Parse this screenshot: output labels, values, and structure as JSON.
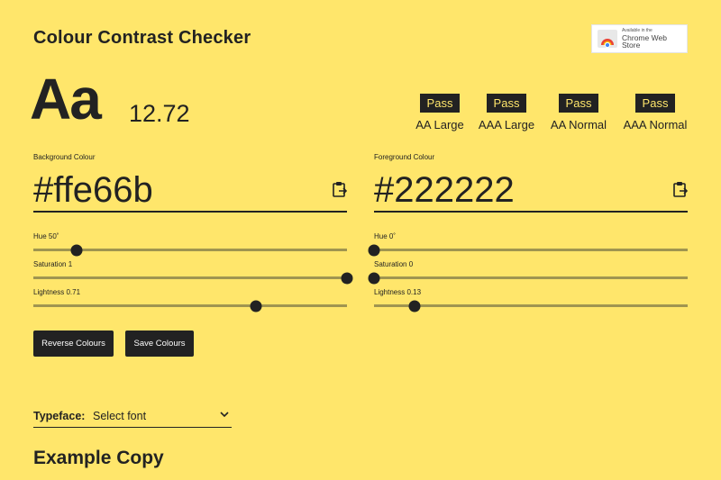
{
  "header": {
    "title": "Colour Contrast Checker"
  },
  "store_badge": {
    "line1": "Available in the",
    "line2": "Chrome Web Store"
  },
  "sample": {
    "glyphs": "Aa",
    "ratio": "12.72"
  },
  "ratings": [
    {
      "status": "Pass",
      "label": "AA Large"
    },
    {
      "status": "Pass",
      "label": "AAA Large"
    },
    {
      "status": "Pass",
      "label": "AA Normal"
    },
    {
      "status": "Pass",
      "label": "AAA Normal"
    }
  ],
  "background": {
    "label": "Background Colour",
    "hex": "#ffe66b",
    "hue_label": "Hue 50˚",
    "hue": 50,
    "saturation_label": "Saturation 1",
    "saturation": 1,
    "lightness_label": "Lightness 0.71",
    "lightness": 0.71
  },
  "foreground": {
    "label": "Foreground Colour",
    "hex": "#222222",
    "hue_label": "Hue 0˚",
    "hue": 0,
    "saturation_label": "Saturation 0",
    "saturation": 0,
    "lightness_label": "Lightness 0.13",
    "lightness": 0.13
  },
  "buttons": {
    "reverse": "Reverse Colours",
    "save": "Save Colours"
  },
  "typeface": {
    "label": "Typeface:",
    "value": "Select font"
  },
  "example": {
    "heading": "Example Copy"
  },
  "colors": {
    "page_bg": "#ffe66b",
    "text": "#222222",
    "track": "#a09550"
  }
}
